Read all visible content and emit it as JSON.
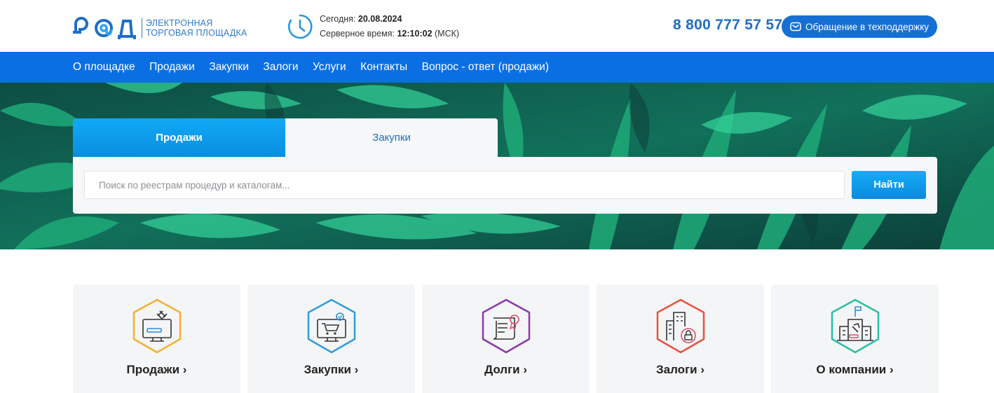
{
  "header": {
    "logo_mark": "РАД",
    "logo_line1": "ЭЛЕКТРОННАЯ",
    "logo_line2": "ТОРГОВАЯ ПЛОЩАДКА",
    "today_label": "Сегодня:",
    "today_value": "20.08.2024",
    "server_time_label": "Серверное время:",
    "server_time_value": "12:10:02",
    "server_tz": "(МСК)",
    "phone": "8 800 777 57 57",
    "support_button": "Обращение в техподдержку"
  },
  "nav": {
    "items": [
      {
        "label": "О площадке"
      },
      {
        "label": "Продажи"
      },
      {
        "label": "Закупки"
      },
      {
        "label": "Залоги"
      },
      {
        "label": "Услуги"
      },
      {
        "label": "Контакты"
      },
      {
        "label": "Вопрос - ответ (продажи)"
      }
    ]
  },
  "search": {
    "tab_active": "Продажи",
    "tab_inactive": "Закупки",
    "placeholder": "Поиск по реестрам процедур и каталогам...",
    "value": "",
    "button": "Найти"
  },
  "cards": [
    {
      "label": "Продажи ›",
      "icon": "auction-monitor-icon",
      "color": "#f2b233"
    },
    {
      "label": "Закупки ›",
      "icon": "shopping-cart-monitor-icon",
      "color": "#2f9ed8"
    },
    {
      "label": "Долги ›",
      "icon": "certificate-document-icon",
      "color": "#8a3aa8"
    },
    {
      "label": "Залоги ›",
      "icon": "building-lock-icon",
      "color": "#e8533f"
    },
    {
      "label": "О компании ›",
      "icon": "company-building-icon",
      "color": "#2bbfa6"
    }
  ],
  "colors": {
    "brand": "#1670d3",
    "nav_bg": "#0a6fe3",
    "accent": "#10a9f5"
  }
}
